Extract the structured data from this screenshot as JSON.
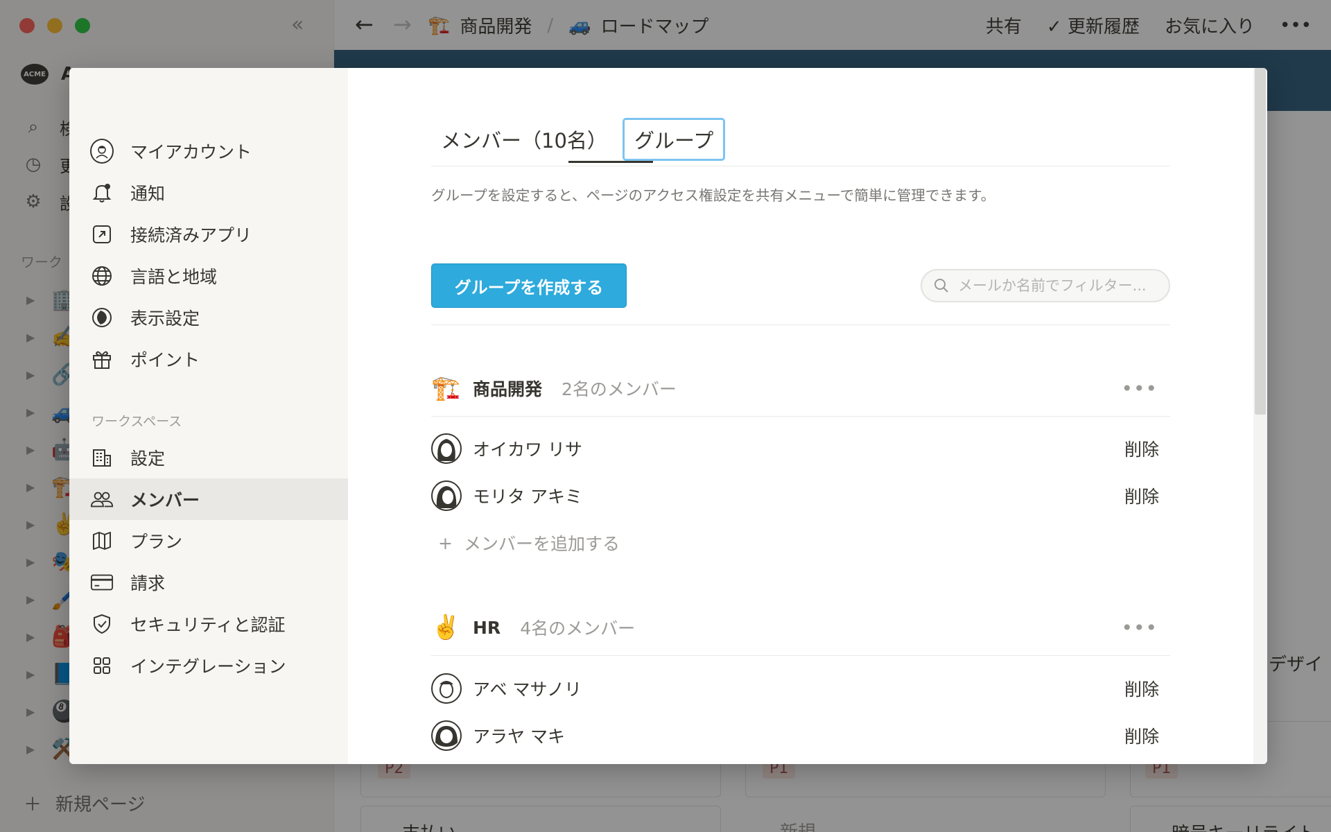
{
  "app": {
    "collapse_glyph": "«",
    "workspace_initial": "A",
    "workspace_logo": "ACME",
    "sidebar_nav": [
      {
        "icon": "search-icon",
        "glyph": "⌕",
        "label": "検"
      },
      {
        "icon": "clock-icon",
        "glyph": "◷",
        "label": "更"
      },
      {
        "icon": "gear-icon",
        "glyph": "⚙",
        "label": "設"
      }
    ],
    "workspace_section": "ワーク",
    "pages": [
      "🏢",
      "✍️",
      "🔗",
      "🚙",
      "🤖",
      "🏗️",
      "✌️",
      "🎭",
      "🖌️",
      "🎒",
      "📘",
      "🎱",
      "⚒️"
    ],
    "new_page": "新規ページ",
    "breadcrumb": [
      {
        "emoji": "🏗️",
        "label": "商品開発"
      },
      {
        "emoji": "🚙",
        "label": "ロードマップ"
      }
    ],
    "breadcrumb_sep": "/",
    "top_actions": {
      "share": "共有",
      "updates": "更新履歴",
      "favorite": "お気に入り",
      "more": "•••"
    },
    "background_bits": {
      "tag_p2": "P2",
      "tag_p1a": "P1",
      "tag_p1b": "P1",
      "text_design": "デザイ",
      "text_payment": "支払い",
      "text_new": "新規",
      "text_crypto": "暗号キーリライト"
    }
  },
  "modal": {
    "sidebar": {
      "account_items": [
        {
          "id": "my-account",
          "label": "マイアカウント",
          "icon": "avatar-icon"
        },
        {
          "id": "notifications",
          "label": "通知",
          "icon": "bell-icon"
        },
        {
          "id": "connected-apps",
          "label": "接続済みアプリ",
          "icon": "external-link-icon"
        },
        {
          "id": "language-region",
          "label": "言語と地域",
          "icon": "globe-icon"
        },
        {
          "id": "appearance",
          "label": "表示設定",
          "icon": "moon-icon"
        },
        {
          "id": "points",
          "label": "ポイント",
          "icon": "gift-icon"
        }
      ],
      "workspace_label": "ワークスペース",
      "workspace_items": [
        {
          "id": "settings",
          "label": "設定",
          "icon": "building-icon"
        },
        {
          "id": "members",
          "label": "メンバー",
          "icon": "people-icon",
          "active": true
        },
        {
          "id": "plans",
          "label": "プラン",
          "icon": "map-icon"
        },
        {
          "id": "billing",
          "label": "請求",
          "icon": "credit-card-icon"
        },
        {
          "id": "security",
          "label": "セキュリティと認証",
          "icon": "shield-icon"
        },
        {
          "id": "integrations",
          "label": "インテグレーション",
          "icon": "grid-icon"
        }
      ]
    },
    "tabs": {
      "members": "メンバー（10名）",
      "groups": "グループ"
    },
    "description": "グループを設定すると、ページのアクセス権設定を共有メニューで簡単に管理できます。",
    "create_button": "グループを作成する",
    "search_placeholder": "メールか名前でフィルター...",
    "groups": [
      {
        "emoji": "🏗️",
        "name": "商品開発",
        "count": "2名のメンバー",
        "members": [
          {
            "name": "オイカワ リサ",
            "remove": "削除"
          },
          {
            "name": "モリタ アキミ",
            "remove": "削除"
          }
        ],
        "add_member": "メンバーを追加する"
      },
      {
        "emoji": "✌️",
        "name": "HR",
        "count": "4名のメンバー",
        "members": [
          {
            "name": "アベ マサノリ",
            "remove": "削除"
          },
          {
            "name": "アラヤ マキ",
            "remove": "削除"
          }
        ]
      }
    ],
    "more_glyph": "•••",
    "plus_glyph": "+"
  }
}
